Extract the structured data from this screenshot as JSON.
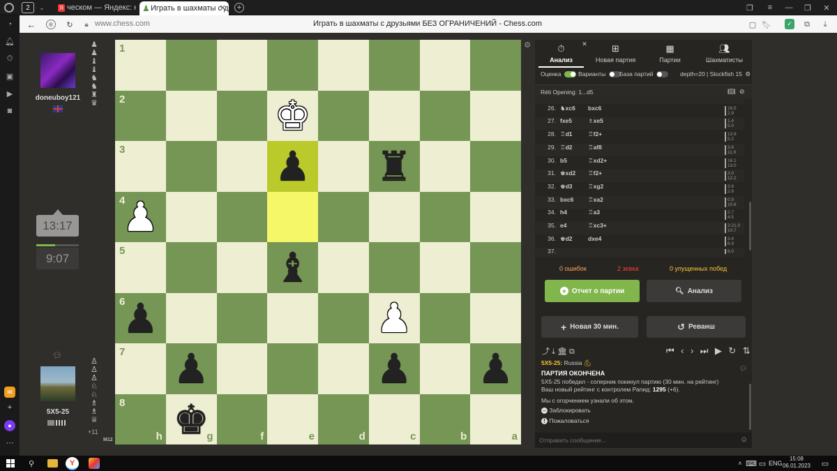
{
  "browser": {
    "tab_count": "2",
    "tabs": [
      {
        "title": "ческом — Яндекс: нашло"
      },
      {
        "title": "Играть в шахматы с др"
      }
    ],
    "url": "www.chess.com",
    "page_title": "Играть в шахматы с друзьями БЕЗ ОГРАНИЧЕНИЙ - Chess.com"
  },
  "board": {
    "ranks": [
      "1",
      "2",
      "3",
      "4",
      "5",
      "6",
      "7",
      "8"
    ],
    "files": [
      "h",
      "g",
      "f",
      "e",
      "d",
      "c",
      "b",
      "a"
    ],
    "pieces": [
      {
        "square": "e2",
        "piece": "king",
        "color": "white"
      },
      {
        "square": "e3",
        "piece": "pawn",
        "color": "black"
      },
      {
        "square": "c3",
        "piece": "rook",
        "color": "black"
      },
      {
        "square": "h4",
        "piece": "pawn",
        "color": "white"
      },
      {
        "square": "e5",
        "piece": "bishop",
        "color": "black"
      },
      {
        "square": "h6",
        "piece": "pawn",
        "color": "black"
      },
      {
        "square": "c6",
        "piece": "pawn",
        "color": "white"
      },
      {
        "square": "g7",
        "piece": "pawn",
        "color": "black"
      },
      {
        "square": "c7",
        "piece": "pawn",
        "color": "black"
      },
      {
        "square": "a7",
        "piece": "pawn",
        "color": "black"
      },
      {
        "square": "g8",
        "piece": "king",
        "color": "black"
      }
    ],
    "highlighted": [
      "e3",
      "e4"
    ]
  },
  "players": {
    "top": {
      "name": "doneuboy121",
      "flag": "uk-flag",
      "clock": "13:17"
    },
    "bottom": {
      "name": "5X5-25",
      "clock": "9:07",
      "material_advantage": "+11",
      "rating_tag": "M12"
    }
  },
  "panel": {
    "nav_tabs": [
      {
        "label": "Анализ",
        "icon": "stopwatch-icon"
      },
      {
        "label": "Новая партия",
        "icon": "plus-icon"
      },
      {
        "label": "Партии",
        "icon": "board-icon"
      },
      {
        "label": "Шахматисты",
        "icon": "players-icon"
      }
    ],
    "toggles": [
      {
        "label": "Оценка",
        "on": true
      },
      {
        "label": "Варианты",
        "on": false
      },
      {
        "label": "База партий",
        "on": false
      }
    ],
    "engine": "depth=20 | Stockfish 15",
    "opening": "Réti Opening: 1...d5",
    "moves": [
      {
        "n": "25.",
        "w": "b4",
        "b": "e5",
        "ev": [
          "12.3"
        ]
      },
      {
        "n": "26.",
        "w": "♞xc6",
        "b": "bxc6",
        "ev": [
          "16.5",
          "2.9"
        ]
      },
      {
        "n": "27.",
        "w": "fxe5",
        "b": "♗xe5",
        "ev": [
          "1.4",
          "5.0"
        ]
      },
      {
        "n": "28.",
        "w": "♖d1",
        "b": "♖f2+",
        "ev": [
          "13.9",
          "5.2"
        ]
      },
      {
        "n": "29.",
        "w": "♖d2",
        "b": "♖af8",
        "ev": [
          "3.6",
          "11.9"
        ]
      },
      {
        "n": "30.",
        "w": "b5",
        "b": "♖xd2+",
        "ev": [
          "16.1",
          "13.0"
        ]
      },
      {
        "n": "31.",
        "w": "♚xd2",
        "b": "♖f2+",
        "ev": [
          "3.0",
          "12.2"
        ]
      },
      {
        "n": "32.",
        "w": "♚d3",
        "b": "♖xg2",
        "ev": [
          "3.9",
          "2.8"
        ]
      },
      {
        "n": "33.",
        "w": "bxc6",
        "b": "♖xa2",
        "ev": [
          "0.9",
          "10.6"
        ]
      },
      {
        "n": "34.",
        "w": "h4",
        "b": "♖a3",
        "ev": [
          "2.7",
          "4.5"
        ]
      },
      {
        "n": "35.",
        "w": "e4",
        "b": "♖xc3+",
        "ev": [
          "2:21.0",
          "10.7"
        ]
      },
      {
        "n": "36.",
        "w": "♚d2",
        "b": "dxe4",
        "ev": [
          "3.4",
          "6.9"
        ]
      },
      {
        "n": "37.",
        "w": "",
        "b": "",
        "ev": [
          "6.0"
        ]
      }
    ],
    "summary": {
      "mistakes": "0 ошибок",
      "blunders": "2 зевка",
      "missed": "0 упущенных побед"
    },
    "buttons": {
      "report": "Отчет о партии",
      "analysis": "Анализ",
      "new_game": "Новая 30 мин.",
      "rematch": "Реванш"
    },
    "chat": {
      "player_line": "5X5-25:",
      "country": "Russia",
      "title": "ПАРТИЯ ОКОНЧЕНА",
      "line1": "5X5-25 победил - соперник покинул партию (30 мин. на рейтинг)",
      "line2_prefix": "Ваш новый рейтинг с контролем Рапид:",
      "rating": "1295",
      "rating_delta": "(+6).",
      "line3": "Мы с огорчением узнали об этом.",
      "block": "Заблокировать",
      "report": "Пожаловаться",
      "placeholder": "Отправить сообщение..."
    },
    "colors": {
      "accent": "#81b64c",
      "blunder": "#fa412d",
      "missed": "#f7c631",
      "mistake": "#ffa459"
    }
  },
  "taskbar": {
    "lang": "ENG",
    "time": "15:08",
    "date": "06.01.2023"
  }
}
